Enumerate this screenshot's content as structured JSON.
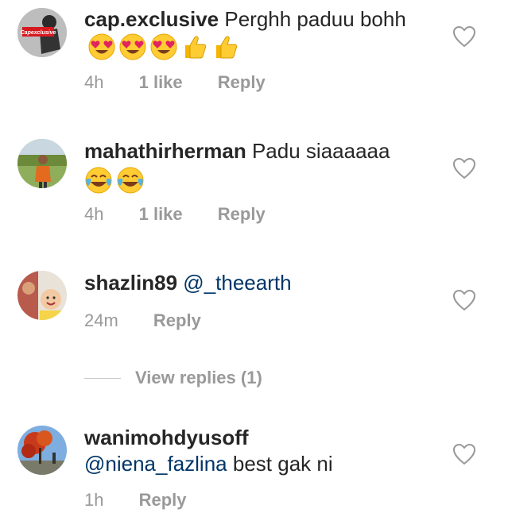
{
  "comments": [
    {
      "username": "cap.exclusive",
      "text": "Perghh paduu bohh",
      "avatar_label": "Capexclusive",
      "emojis": [
        "heart-eyes-emoji",
        "heart-eyes-emoji",
        "heart-eyes-emoji",
        "thumbs-up-emoji",
        "thumbs-up-emoji"
      ],
      "time": "4h",
      "likes": "1 like",
      "reply": "Reply"
    },
    {
      "username": "mahathirherman",
      "text": "Padu siaaaaaa",
      "emojis": [
        "tears-of-joy-emoji",
        "tears-of-joy-emoji"
      ],
      "time": "4h",
      "likes": "1 like",
      "reply": "Reply"
    },
    {
      "username": "shazlin89",
      "mention": "@_theearth",
      "time": "24m",
      "reply": "Reply",
      "view_replies": "View replies (1)"
    },
    {
      "username": "wanimohdyusoff",
      "mention": "@niena_fazlina",
      "text": "best gak ni",
      "time": "1h",
      "reply": "Reply"
    }
  ],
  "colors": {
    "text": "#262626",
    "meta": "#999999",
    "mention": "#003569",
    "heart_outline": "#999999"
  }
}
